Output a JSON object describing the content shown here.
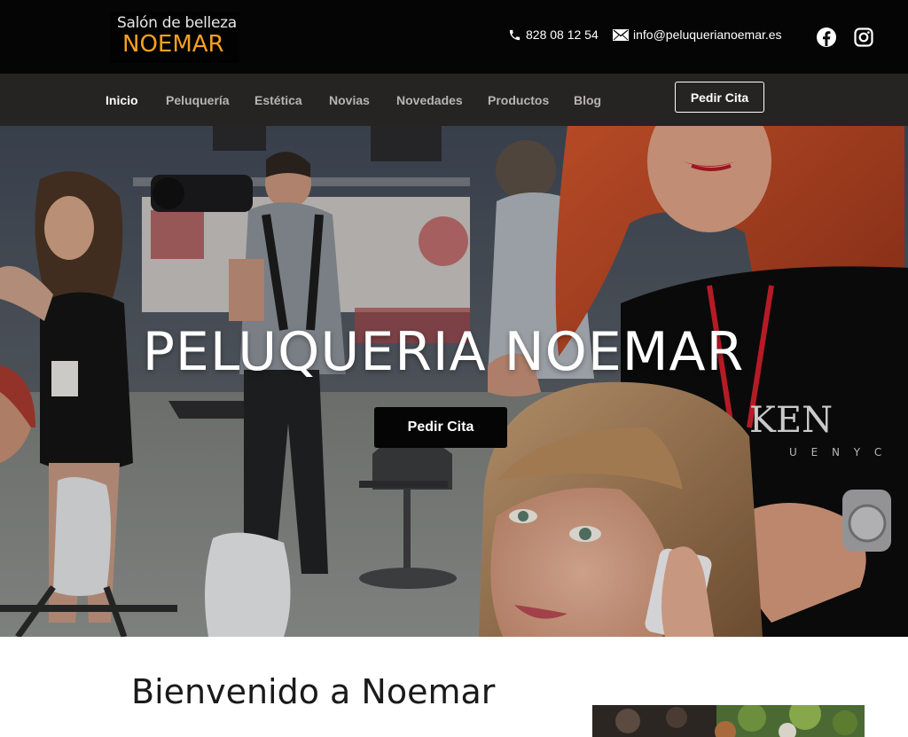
{
  "header": {
    "logo": {
      "line1": "Salón de belleza",
      "line2": "NOEMAR"
    },
    "phone": {
      "icon": "phone-icon",
      "text": "828 08 12 54"
    },
    "email": {
      "icon": "envelope-icon",
      "text": "info@peluquerianoemar.es"
    },
    "social": [
      {
        "name": "facebook",
        "icon": "facebook-icon"
      },
      {
        "name": "instagram",
        "icon": "instagram-icon"
      }
    ]
  },
  "nav": {
    "items": [
      {
        "label": "Inicio",
        "active": true
      },
      {
        "label": "Peluquería",
        "active": false
      },
      {
        "label": "Estética",
        "active": false
      },
      {
        "label": "Novias",
        "active": false
      },
      {
        "label": "Novedades",
        "active": false
      },
      {
        "label": "Productos",
        "active": false
      },
      {
        "label": "Blog",
        "active": false
      }
    ],
    "cta_label": "Pedir Cita"
  },
  "hero": {
    "title": "PELUQUERIA NOEMAR",
    "cta_label": "Pedir Cita"
  },
  "welcome": {
    "title": "Bienvenido a Noemar"
  },
  "colors": {
    "topbar_bg": "#050505",
    "nav_bg": "#262323",
    "logo_accent": "#f3a21d",
    "nav_text": "#b7b4b4",
    "nav_active": "#ffffff"
  }
}
